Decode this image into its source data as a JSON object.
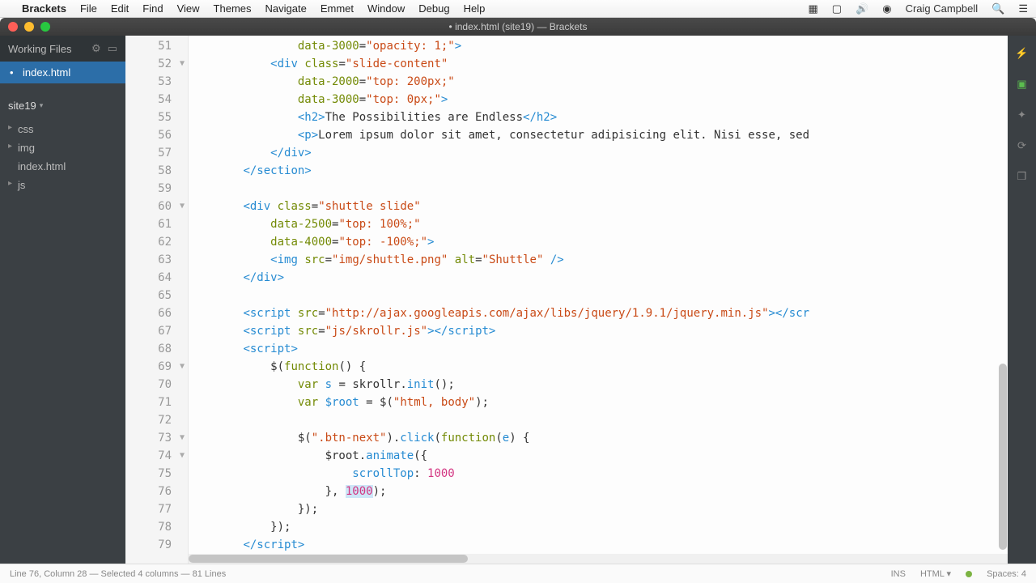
{
  "menubar": {
    "app": "Brackets",
    "items": [
      "File",
      "Edit",
      "Find",
      "View",
      "Themes",
      "Navigate",
      "Emmet",
      "Window",
      "Debug",
      "Help"
    ],
    "user": "Craig Campbell"
  },
  "window": {
    "title": "• index.html (site19) — Brackets"
  },
  "sidebar": {
    "working_files_label": "Working Files",
    "working_file": "index.html",
    "project_name": "site19",
    "tree": [
      {
        "label": "css",
        "type": "folder"
      },
      {
        "label": "img",
        "type": "folder"
      },
      {
        "label": "index.html",
        "type": "file"
      },
      {
        "label": "js",
        "type": "folder"
      }
    ]
  },
  "editor": {
    "first_line": 51,
    "last_line": 79,
    "fold_lines": [
      52,
      60,
      69,
      73,
      74
    ],
    "lines": [
      {
        "n": 51,
        "html": "                <span class='attr'>data-3000</span>=<span class='str'>\"opacity: 1;\"</span><span class='tag'>&gt;</span>"
      },
      {
        "n": 52,
        "html": "            <span class='tag'>&lt;div</span> <span class='attr'>class</span>=<span class='str'>\"slide-content\"</span>"
      },
      {
        "n": 53,
        "html": "                <span class='attr'>data-2000</span>=<span class='str'>\"top: 200px;\"</span>"
      },
      {
        "n": 54,
        "html": "                <span class='attr'>data-3000</span>=<span class='str'>\"top: 0px;\"</span><span class='tag'>&gt;</span>"
      },
      {
        "n": 55,
        "html": "                <span class='tag'>&lt;h2&gt;</span>The Possibilities are Endless<span class='tag'>&lt;/h2&gt;</span>"
      },
      {
        "n": 56,
        "html": "                <span class='tag'>&lt;p&gt;</span>Lorem ipsum dolor sit amet, consectetur adipisicing elit. Nisi esse, sed"
      },
      {
        "n": 57,
        "html": "            <span class='tag'>&lt;/div&gt;</span>"
      },
      {
        "n": 58,
        "html": "        <span class='tag'>&lt;/section&gt;</span>"
      },
      {
        "n": 59,
        "html": ""
      },
      {
        "n": 60,
        "html": "        <span class='tag'>&lt;div</span> <span class='attr'>class</span>=<span class='str'>\"shuttle slide\"</span>"
      },
      {
        "n": 61,
        "html": "            <span class='attr'>data-2500</span>=<span class='str'>\"top: 100%;\"</span>"
      },
      {
        "n": 62,
        "html": "            <span class='attr'>data-4000</span>=<span class='str'>\"top: -100%;\"</span><span class='tag'>&gt;</span>"
      },
      {
        "n": 63,
        "html": "            <span class='tag'>&lt;img</span> <span class='attr'>src</span>=<span class='str'>\"img/shuttle.png\"</span> <span class='attr'>alt</span>=<span class='str'>\"Shuttle\"</span> <span class='tag'>/&gt;</span>"
      },
      {
        "n": 64,
        "html": "        <span class='tag'>&lt;/div&gt;</span>"
      },
      {
        "n": 65,
        "html": ""
      },
      {
        "n": 66,
        "html": "        <span class='tag'>&lt;script</span> <span class='attr'>src</span>=<span class='str'>\"http://ajax.googleapis.com/ajax/libs/jquery/1.9.1/jquery.min.js\"</span><span class='tag'>&gt;&lt;/scr</span>"
      },
      {
        "n": 67,
        "html": "        <span class='tag'>&lt;script</span> <span class='attr'>src</span>=<span class='str'>\"js/skrollr.js\"</span><span class='tag'>&gt;&lt;/script&gt;</span>"
      },
      {
        "n": 68,
        "html": "        <span class='tag'>&lt;script&gt;</span>"
      },
      {
        "n": 69,
        "html": "            $(<span class='kw'>function</span>() {"
      },
      {
        "n": 70,
        "html": "                <span class='kw'>var</span> <span class='var'>s</span> = skrollr.<span class='fn'>init</span>();"
      },
      {
        "n": 71,
        "html": "                <span class='kw'>var</span> <span class='var'>$root</span> = $(<span class='str'>\"html, body\"</span>);"
      },
      {
        "n": 72,
        "html": ""
      },
      {
        "n": 73,
        "html": "                $(<span class='str'>\".btn-next\"</span>).<span class='fn'>click</span>(<span class='kw'>function</span>(<span class='var'>e</span>) {"
      },
      {
        "n": 74,
        "html": "                    $root.<span class='fn'>animate</span>({"
      },
      {
        "n": 75,
        "html": "                        <span class='var'>scrollTop</span>: <span class='num'>1000</span>"
      },
      {
        "n": 76,
        "html": "                    }, <span class='sel-hl'><span class='num'>1000</span></span>);"
      },
      {
        "n": 77,
        "html": "                });"
      },
      {
        "n": 78,
        "html": "            });"
      },
      {
        "n": 79,
        "html": "        <span class='tag'>&lt;/script&gt;</span>"
      }
    ]
  },
  "statusbar": {
    "left": "Line 76, Column 28 — Selected 4 columns — 81 Lines",
    "ins": "INS",
    "lang": "HTML",
    "spaces": "Spaces: 4"
  }
}
